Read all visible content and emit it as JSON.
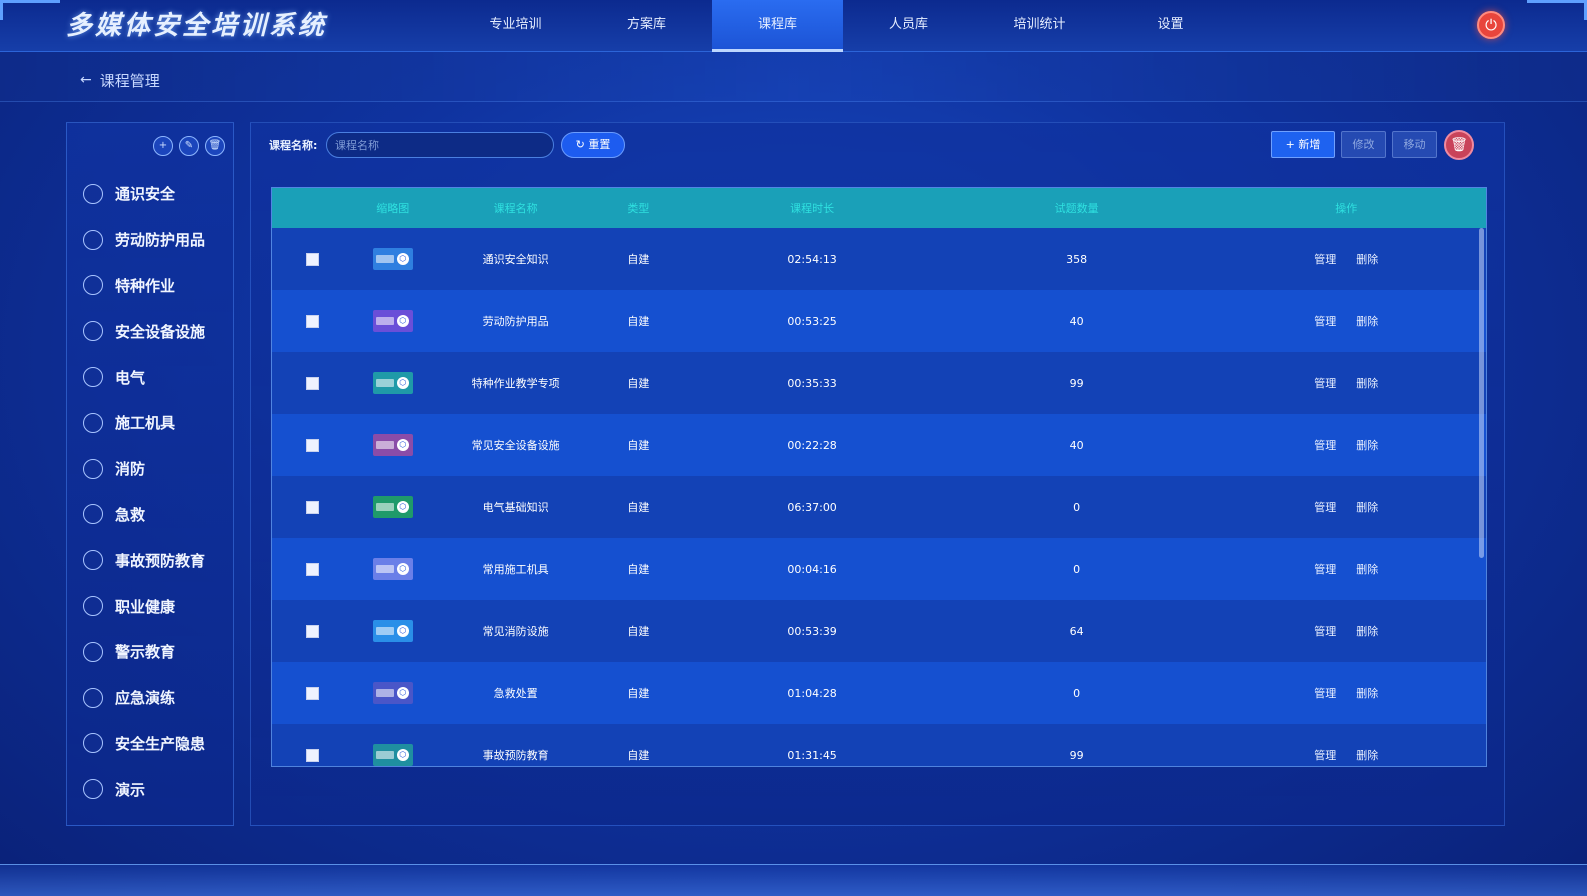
{
  "app": {
    "title": "多媒体安全培训系统"
  },
  "nav": {
    "tabs": [
      {
        "label": "专业培训",
        "active": false
      },
      {
        "label": "方案库",
        "active": false
      },
      {
        "label": "课程库",
        "active": true
      },
      {
        "label": "人员库",
        "active": false
      },
      {
        "label": "培训统计",
        "active": false
      },
      {
        "label": "设置",
        "active": false
      }
    ]
  },
  "breadcrumb": {
    "title": "课程管理"
  },
  "sidebar": {
    "categories": [
      {
        "label": "通识安全"
      },
      {
        "label": "劳动防护用品"
      },
      {
        "label": "特种作业"
      },
      {
        "label": "安全设备设施"
      },
      {
        "label": "电气"
      },
      {
        "label": "施工机具"
      },
      {
        "label": "消防"
      },
      {
        "label": "急救"
      },
      {
        "label": "事故预防教育"
      },
      {
        "label": "职业健康"
      },
      {
        "label": "警示教育"
      },
      {
        "label": "应急演练"
      },
      {
        "label": "安全生产隐患"
      },
      {
        "label": "演示"
      }
    ]
  },
  "search": {
    "label": "课程名称:",
    "placeholder": "课程名称",
    "value": "",
    "reset_label": "重置"
  },
  "toolbar": {
    "add_label": "+ 新增",
    "edit_label": "修改",
    "move_label": "移动"
  },
  "table": {
    "headers": {
      "thumb": "缩略图",
      "name": "课程名称",
      "type": "类型",
      "duration": "课程时长",
      "count": "试题数量",
      "ops": "操作"
    },
    "op_manage": "管理",
    "op_delete": "删除",
    "rows": [
      {
        "name": "通识安全知识",
        "type": "自建",
        "duration": "02:54:13",
        "count": "358",
        "thumb_color": "#2f7fe0"
      },
      {
        "name": "劳动防护用品",
        "type": "自建",
        "duration": "00:53:25",
        "count": "40",
        "thumb_color": "#6a4fd8"
      },
      {
        "name": "特种作业教学专项",
        "type": "自建",
        "duration": "00:35:33",
        "count": "99",
        "thumb_color": "#1f9aa8"
      },
      {
        "name": "常见安全设备设施",
        "type": "自建",
        "duration": "00:22:28",
        "count": "40",
        "thumb_color": "#8a4ca8"
      },
      {
        "name": "电气基础知识",
        "type": "自建",
        "duration": "06:37:00",
        "count": "0",
        "thumb_color": "#1f9a6a"
      },
      {
        "name": "常用施工机具",
        "type": "自建",
        "duration": "00:04:16",
        "count": "0",
        "thumb_color": "#6a7fe8"
      },
      {
        "name": "常见消防设施",
        "type": "自建",
        "duration": "00:53:39",
        "count": "64",
        "thumb_color": "#2a8fe8"
      },
      {
        "name": "急救处置",
        "type": "自建",
        "duration": "01:04:28",
        "count": "0",
        "thumb_color": "#4a56c8"
      },
      {
        "name": "事故预防教育",
        "type": "自建",
        "duration": "01:31:45",
        "count": "99",
        "thumb_color": "#1f8fa0"
      }
    ]
  }
}
